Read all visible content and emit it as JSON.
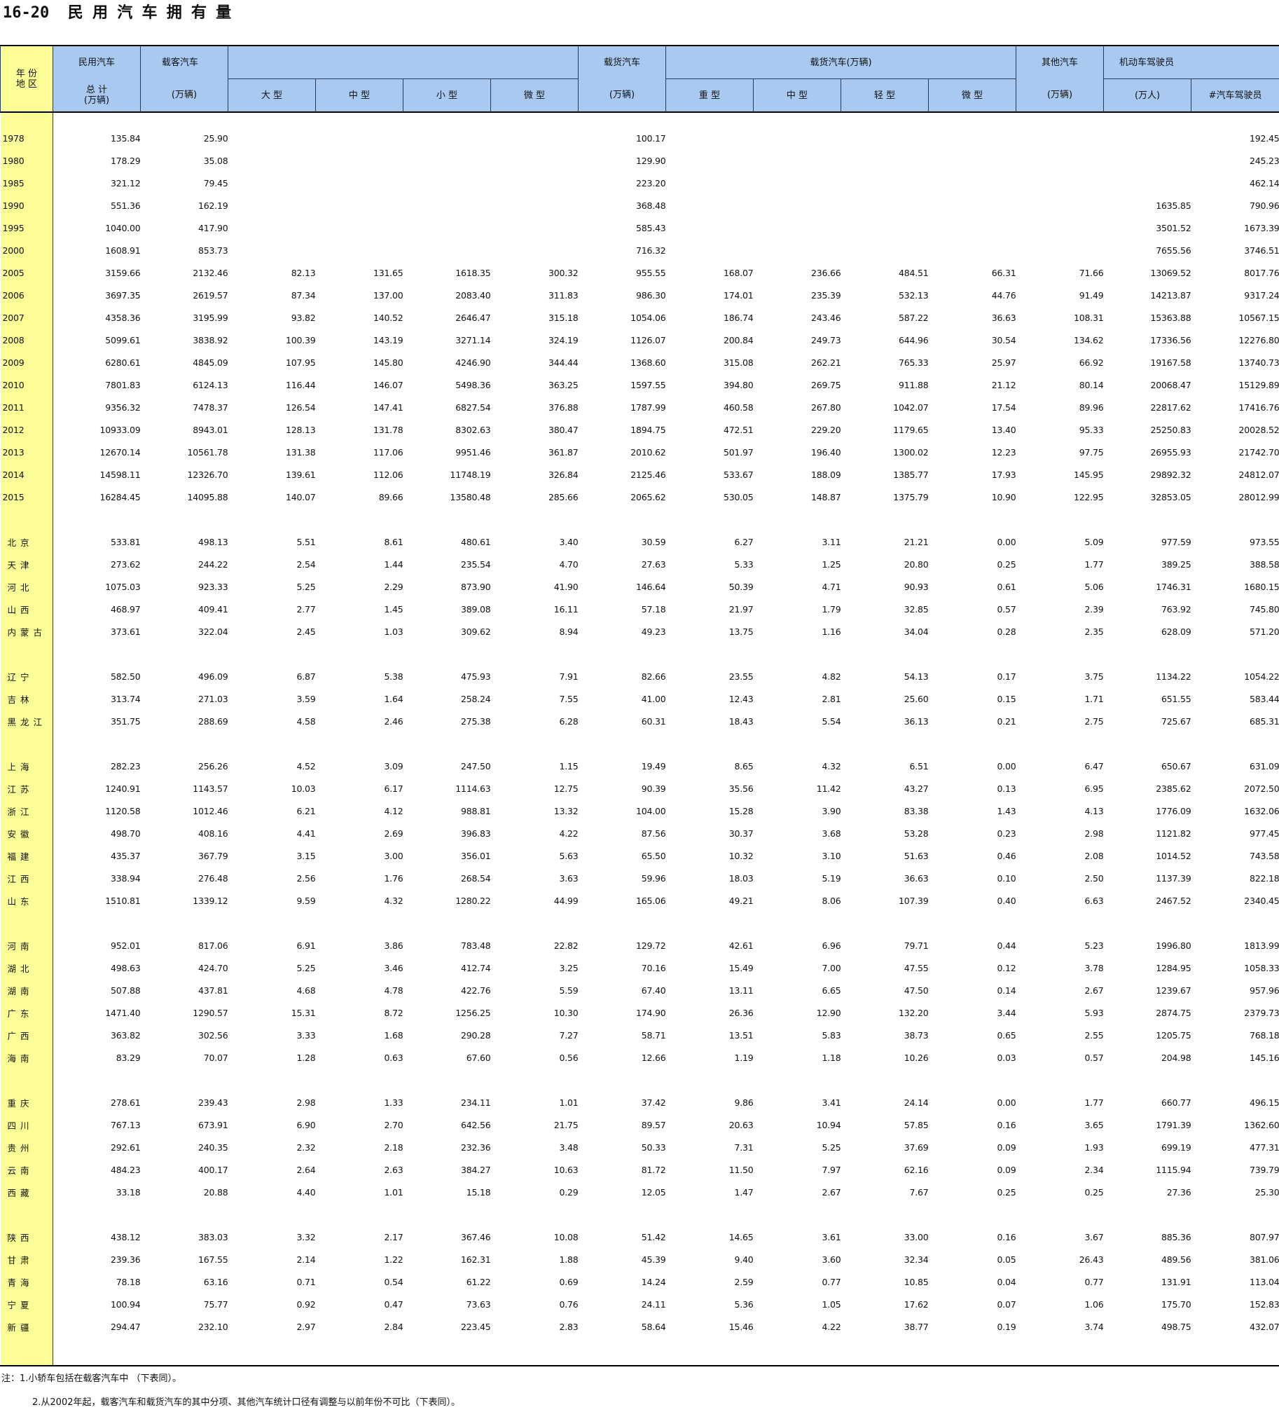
{
  "title": "16-20  民 用 汽 车 拥 有 量",
  "header": {
    "year_region": "年 份\n地 区",
    "civil_total_top": "民用汽车",
    "civil_total_bottom": "总  计\n(万辆)",
    "passenger_top": "载客汽车",
    "passenger_unit": "(万辆)",
    "large": "大  型",
    "medium": "中  型",
    "small": "小  型",
    "mini": "微  型",
    "truck_total_top": "载货汽车",
    "truck_total_unit": "(万辆)",
    "truck_group": "载货汽车(万辆)",
    "heavy": "重  型",
    "truck_medium": "中  型",
    "light": "轻  型",
    "truck_mini": "微  型",
    "other_top": "其他汽车",
    "other_unit": "(万辆)",
    "drivers_top": "机动车驾驶员",
    "drivers_unit": "(万人)",
    "car_drivers": "#汽车驾驶员"
  },
  "year_rows": [
    [
      "1978",
      "135.84",
      "25.90",
      "",
      "",
      "",
      "",
      "100.17",
      "",
      "",
      "",
      "",
      "",
      "",
      "192.45"
    ],
    [
      "1980",
      "178.29",
      "35.08",
      "",
      "",
      "",
      "",
      "129.90",
      "",
      "",
      "",
      "",
      "",
      "",
      "245.23"
    ],
    [
      "1985",
      "321.12",
      "79.45",
      "",
      "",
      "",
      "",
      "223.20",
      "",
      "",
      "",
      "",
      "",
      "",
      "462.14"
    ],
    [
      "1990",
      "551.36",
      "162.19",
      "",
      "",
      "",
      "",
      "368.48",
      "",
      "",
      "",
      "",
      "",
      "1635.85",
      "790.96"
    ],
    [
      "1995",
      "1040.00",
      "417.90",
      "",
      "",
      "",
      "",
      "585.43",
      "",
      "",
      "",
      "",
      "",
      "3501.52",
      "1673.39"
    ],
    [
      "2000",
      "1608.91",
      "853.73",
      "",
      "",
      "",
      "",
      "716.32",
      "",
      "",
      "",
      "",
      "",
      "7655.56",
      "3746.51"
    ],
    [
      "2005",
      "3159.66",
      "2132.46",
      "82.13",
      "131.65",
      "1618.35",
      "300.32",
      "955.55",
      "168.07",
      "236.66",
      "484.51",
      "66.31",
      "71.66",
      "13069.52",
      "8017.76"
    ],
    [
      "2006",
      "3697.35",
      "2619.57",
      "87.34",
      "137.00",
      "2083.40",
      "311.83",
      "986.30",
      "174.01",
      "235.39",
      "532.13",
      "44.76",
      "91.49",
      "14213.87",
      "9317.24"
    ],
    [
      "2007",
      "4358.36",
      "3195.99",
      "93.82",
      "140.52",
      "2646.47",
      "315.18",
      "1054.06",
      "186.74",
      "243.46",
      "587.22",
      "36.63",
      "108.31",
      "15363.88",
      "10567.15"
    ],
    [
      "2008",
      "5099.61",
      "3838.92",
      "100.39",
      "143.19",
      "3271.14",
      "324.19",
      "1126.07",
      "200.84",
      "249.73",
      "644.96",
      "30.54",
      "134.62",
      "17336.56",
      "12276.80"
    ],
    [
      "2009",
      "6280.61",
      "4845.09",
      "107.95",
      "145.80",
      "4246.90",
      "344.44",
      "1368.60",
      "315.08",
      "262.21",
      "765.33",
      "25.97",
      "66.92",
      "19167.58",
      "13740.73"
    ],
    [
      "2010",
      "7801.83",
      "6124.13",
      "116.44",
      "146.07",
      "5498.36",
      "363.25",
      "1597.55",
      "394.80",
      "269.75",
      "911.88",
      "21.12",
      "80.14",
      "20068.47",
      "15129.89"
    ],
    [
      "2011",
      "9356.32",
      "7478.37",
      "126.54",
      "147.41",
      "6827.54",
      "376.88",
      "1787.99",
      "460.58",
      "267.80",
      "1042.07",
      "17.54",
      "89.96",
      "22817.62",
      "17416.76"
    ],
    [
      "2012",
      "10933.09",
      "8943.01",
      "128.13",
      "131.78",
      "8302.63",
      "380.47",
      "1894.75",
      "472.51",
      "229.20",
      "1179.65",
      "13.40",
      "95.33",
      "25250.83",
      "20028.52"
    ],
    [
      "2013",
      "12670.14",
      "10561.78",
      "131.38",
      "117.06",
      "9951.46",
      "361.87",
      "2010.62",
      "501.97",
      "196.40",
      "1300.02",
      "12.23",
      "97.75",
      "26955.93",
      "21742.70"
    ],
    [
      "2014",
      "14598.11",
      "12326.70",
      "139.61",
      "112.06",
      "11748.19",
      "326.84",
      "2125.46",
      "533.67",
      "188.09",
      "1385.77",
      "17.93",
      "145.95",
      "29892.32",
      "24812.07"
    ],
    [
      "2015",
      "16284.45",
      "14095.88",
      "140.07",
      "89.66",
      "13580.48",
      "285.66",
      "2065.62",
      "530.05",
      "148.87",
      "1375.79",
      "10.90",
      "122.95",
      "32853.05",
      "28012.99"
    ]
  ],
  "region_groups": [
    [
      [
        "北京",
        "533.81",
        "498.13",
        "5.51",
        "8.61",
        "480.61",
        "3.40",
        "30.59",
        "6.27",
        "3.11",
        "21.21",
        "0.00",
        "5.09",
        "977.59",
        "973.55"
      ],
      [
        "天津",
        "273.62",
        "244.22",
        "2.54",
        "1.44",
        "235.54",
        "4.70",
        "27.63",
        "5.33",
        "1.25",
        "20.80",
        "0.25",
        "1.77",
        "389.25",
        "388.58"
      ],
      [
        "河北",
        "1075.03",
        "923.33",
        "5.25",
        "2.29",
        "873.90",
        "41.90",
        "146.64",
        "50.39",
        "4.71",
        "90.93",
        "0.61",
        "5.06",
        "1746.31",
        "1680.15"
      ],
      [
        "山西",
        "468.97",
        "409.41",
        "2.77",
        "1.45",
        "389.08",
        "16.11",
        "57.18",
        "21.97",
        "1.79",
        "32.85",
        "0.57",
        "2.39",
        "763.92",
        "745.80"
      ],
      [
        "内蒙古",
        "373.61",
        "322.04",
        "2.45",
        "1.03",
        "309.62",
        "8.94",
        "49.23",
        "13.75",
        "1.16",
        "34.04",
        "0.28",
        "2.35",
        "628.09",
        "571.20"
      ]
    ],
    [
      [
        "辽宁",
        "582.50",
        "496.09",
        "6.87",
        "5.38",
        "475.93",
        "7.91",
        "82.66",
        "23.55",
        "4.82",
        "54.13",
        "0.17",
        "3.75",
        "1134.22",
        "1054.22"
      ],
      [
        "吉林",
        "313.74",
        "271.03",
        "3.59",
        "1.64",
        "258.24",
        "7.55",
        "41.00",
        "12.43",
        "2.81",
        "25.60",
        "0.15",
        "1.71",
        "651.55",
        "583.44"
      ],
      [
        "黑龙江",
        "351.75",
        "288.69",
        "4.58",
        "2.46",
        "275.38",
        "6.28",
        "60.31",
        "18.43",
        "5.54",
        "36.13",
        "0.21",
        "2.75",
        "725.67",
        "685.31"
      ]
    ],
    [
      [
        "上海",
        "282.23",
        "256.26",
        "4.52",
        "3.09",
        "247.50",
        "1.15",
        "19.49",
        "8.65",
        "4.32",
        "6.51",
        "0.00",
        "6.47",
        "650.67",
        "631.09"
      ],
      [
        "江苏",
        "1240.91",
        "1143.57",
        "10.03",
        "6.17",
        "1114.63",
        "12.75",
        "90.39",
        "35.56",
        "11.42",
        "43.27",
        "0.13",
        "6.95",
        "2385.62",
        "2072.50"
      ],
      [
        "浙江",
        "1120.58",
        "1012.46",
        "6.21",
        "4.12",
        "988.81",
        "13.32",
        "104.00",
        "15.28",
        "3.90",
        "83.38",
        "1.43",
        "4.13",
        "1776.09",
        "1632.06"
      ],
      [
        "安徽",
        "498.70",
        "408.16",
        "4.41",
        "2.69",
        "396.83",
        "4.22",
        "87.56",
        "30.37",
        "3.68",
        "53.28",
        "0.23",
        "2.98",
        "1121.82",
        "977.45"
      ],
      [
        "福建",
        "435.37",
        "367.79",
        "3.15",
        "3.00",
        "356.01",
        "5.63",
        "65.50",
        "10.32",
        "3.10",
        "51.63",
        "0.46",
        "2.08",
        "1014.52",
        "743.58"
      ],
      [
        "江西",
        "338.94",
        "276.48",
        "2.56",
        "1.76",
        "268.54",
        "3.63",
        "59.96",
        "18.03",
        "5.19",
        "36.63",
        "0.10",
        "2.50",
        "1137.39",
        "822.18"
      ],
      [
        "山东",
        "1510.81",
        "1339.12",
        "9.59",
        "4.32",
        "1280.22",
        "44.99",
        "165.06",
        "49.21",
        "8.06",
        "107.39",
        "0.40",
        "6.63",
        "2467.52",
        "2340.45"
      ]
    ],
    [
      [
        "河南",
        "952.01",
        "817.06",
        "6.91",
        "3.86",
        "783.48",
        "22.82",
        "129.72",
        "42.61",
        "6.96",
        "79.71",
        "0.44",
        "5.23",
        "1996.80",
        "1813.99"
      ],
      [
        "湖北",
        "498.63",
        "424.70",
        "5.25",
        "3.46",
        "412.74",
        "3.25",
        "70.16",
        "15.49",
        "7.00",
        "47.55",
        "0.12",
        "3.78",
        "1284.95",
        "1058.33"
      ],
      [
        "湖南",
        "507.88",
        "437.81",
        "4.68",
        "4.78",
        "422.76",
        "5.59",
        "67.40",
        "13.11",
        "6.65",
        "47.50",
        "0.14",
        "2.67",
        "1239.67",
        "957.96"
      ],
      [
        "广东",
        "1471.40",
        "1290.57",
        "15.31",
        "8.72",
        "1256.25",
        "10.30",
        "174.90",
        "26.36",
        "12.90",
        "132.20",
        "3.44",
        "5.93",
        "2874.75",
        "2379.73"
      ],
      [
        "广西",
        "363.82",
        "302.56",
        "3.33",
        "1.68",
        "290.28",
        "7.27",
        "58.71",
        "13.51",
        "5.83",
        "38.73",
        "0.65",
        "2.55",
        "1205.75",
        "768.18"
      ],
      [
        "海南",
        "83.29",
        "70.07",
        "1.28",
        "0.63",
        "67.60",
        "0.56",
        "12.66",
        "1.19",
        "1.18",
        "10.26",
        "0.03",
        "0.57",
        "204.98",
        "145.16"
      ]
    ],
    [
      [
        "重庆",
        "278.61",
        "239.43",
        "2.98",
        "1.33",
        "234.11",
        "1.01",
        "37.42",
        "9.86",
        "3.41",
        "24.14",
        "0.00",
        "1.77",
        "660.77",
        "496.15"
      ],
      [
        "四川",
        "767.13",
        "673.91",
        "6.90",
        "2.70",
        "642.56",
        "21.75",
        "89.57",
        "20.63",
        "10.94",
        "57.85",
        "0.16",
        "3.65",
        "1791.39",
        "1362.60"
      ],
      [
        "贵州",
        "292.61",
        "240.35",
        "2.32",
        "2.18",
        "232.36",
        "3.48",
        "50.33",
        "7.31",
        "5.25",
        "37.69",
        "0.09",
        "1.93",
        "699.19",
        "477.31"
      ],
      [
        "云南",
        "484.23",
        "400.17",
        "2.64",
        "2.63",
        "384.27",
        "10.63",
        "81.72",
        "11.50",
        "7.97",
        "62.16",
        "0.09",
        "2.34",
        "1115.94",
        "739.79"
      ],
      [
        "西藏",
        "33.18",
        "20.88",
        "4.40",
        "1.01",
        "15.18",
        "0.29",
        "12.05",
        "1.47",
        "2.67",
        "7.67",
        "0.25",
        "0.25",
        "27.36",
        "25.30"
      ]
    ],
    [
      [
        "陕西",
        "438.12",
        "383.03",
        "3.32",
        "2.17",
        "367.46",
        "10.08",
        "51.42",
        "14.65",
        "3.61",
        "33.00",
        "0.16",
        "3.67",
        "885.36",
        "807.97"
      ],
      [
        "甘肃",
        "239.36",
        "167.55",
        "2.14",
        "1.22",
        "162.31",
        "1.88",
        "45.39",
        "9.40",
        "3.60",
        "32.34",
        "0.05",
        "26.43",
        "489.56",
        "381.06"
      ],
      [
        "青海",
        "78.18",
        "63.16",
        "0.71",
        "0.54",
        "61.22",
        "0.69",
        "14.24",
        "2.59",
        "0.77",
        "10.85",
        "0.04",
        "0.77",
        "131.91",
        "113.04"
      ],
      [
        "宁夏",
        "100.94",
        "75.77",
        "0.92",
        "0.47",
        "73.63",
        "0.76",
        "24.11",
        "5.36",
        "1.05",
        "17.62",
        "0.07",
        "1.06",
        "175.70",
        "152.83"
      ],
      [
        "新疆",
        "294.47",
        "232.10",
        "2.97",
        "2.84",
        "223.45",
        "2.83",
        "58.64",
        "15.46",
        "4.22",
        "38.77",
        "0.19",
        "3.74",
        "498.75",
        "432.07"
      ]
    ]
  ],
  "notes": {
    "note1": "注：1.小轿车包括在载客汽车中 （下表同）。",
    "note2": "2.从2002年起，载客汽车和载货汽车的其中分项、其他汽车统计口径有调整与以前年份不可比（下表同）。"
  }
}
